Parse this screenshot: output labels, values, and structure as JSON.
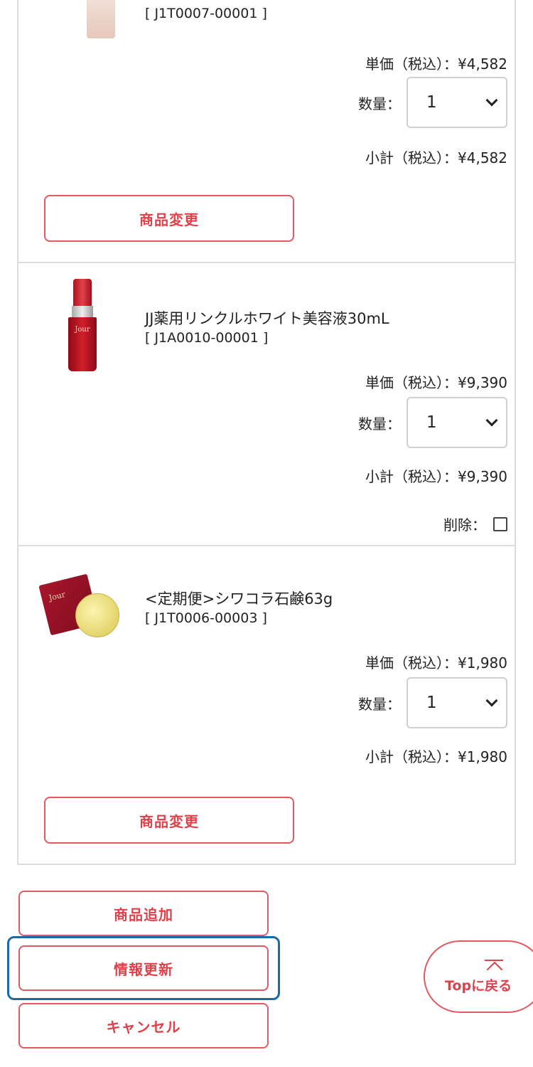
{
  "items": [
    {
      "name": "",
      "code": "[ J1T0007-00001 ]",
      "unit_price": "単価（税込）：¥4,582",
      "qty_label": "数量：",
      "qty_value": "1",
      "subtotal": "小計（税込）：¥4,582",
      "change_button": "商品変更"
    },
    {
      "name": "JJ薬用リンクルホワイト美容液30mL",
      "code": "[ J1A0010-00001 ]",
      "unit_price": "単価（税込）：¥9,390",
      "qty_label": "数量：",
      "qty_value": "1",
      "subtotal": "小計（税込）：¥9,390",
      "delete_label": "削除："
    },
    {
      "name": "<定期便>シワコラ石鹸63g",
      "code": "[ J1T0006-00003 ]",
      "unit_price": "単価（税込）：¥1,980",
      "qty_label": "数量：",
      "qty_value": "1",
      "subtotal": "小計（税込）：¥1,980",
      "change_button": "商品変更"
    }
  ],
  "actions": {
    "add_product": "商品追加",
    "update_info": "情報更新",
    "cancel": "キャンセル"
  },
  "back_to_top": "Topに戻る",
  "colors": {
    "accent": "#e0404a",
    "focus": "#1b6aa8",
    "border": "#dcdcdc"
  },
  "product_logos": {
    "bottle": "Jour",
    "soap": "Jour"
  }
}
